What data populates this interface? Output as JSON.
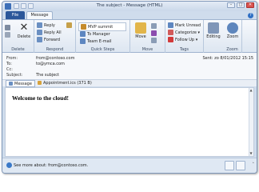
{
  "window": {
    "title": "The subject - Message (HTML)",
    "controls": [
      "–",
      "□",
      "✕"
    ]
  },
  "tabs": {
    "file": "File",
    "message": "Message",
    "help": "?"
  },
  "ribbon": {
    "delete_group": {
      "label": "Delete",
      "delete": "Delete"
    },
    "respond_group": {
      "label": "Respond",
      "reply": "Reply",
      "reply_all": "Reply All",
      "forward": "Forward"
    },
    "quick_steps": {
      "label": "Quick Steps",
      "items": [
        "MVP summit",
        "To Manager",
        "Team E-mail"
      ]
    },
    "move_group": {
      "label": "Move",
      "move": "Move"
    },
    "tags_group": {
      "label": "Tags",
      "mark_unread": "Mark Unread",
      "categorize": "Categorize ▾",
      "follow_up": "Follow Up ▾"
    },
    "editing_group": {
      "editing": "Editing"
    },
    "zoom_group": {
      "label": "Zoom",
      "zoom": "Zoom"
    }
  },
  "header": {
    "from_label": "From:",
    "from_value": "from@contoso.com",
    "to_label": "To:",
    "to_value": "to@ymca.com",
    "cc_label": "Cc:",
    "subject_label": "Subject:",
    "subject_value": "The subject",
    "sent": "Sent:   zo 8/01/2012 15:15"
  },
  "attachments": {
    "message_tab": "Message",
    "file": "Appointment.ics (371 B)"
  },
  "body": {
    "text": "Welcome to the cloud!"
  },
  "footer": {
    "see_more": "See more about: from@contoso.com."
  },
  "colors": {
    "file_tab": "#2b579a",
    "ribbon_bg": "#dde6f1",
    "accent": "#3a79c8"
  }
}
